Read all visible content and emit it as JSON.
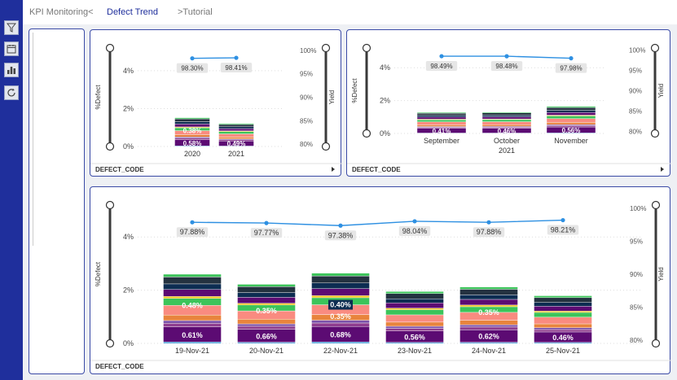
{
  "nav": {
    "kpi": "KPI Monitoring",
    "kpi_chevron": "<",
    "defect": "Defect Trend",
    "tutorial": ">Tutorial"
  },
  "sidebar": {
    "icons": [
      "filter-icon",
      "calendar-icon",
      "bar-chart-icon",
      "refresh-icon"
    ]
  },
  "colors": {
    "segments": [
      "#5c0b73",
      "#2d8fd0",
      "#8e3d8f",
      "#f98b80",
      "#e8843d",
      "#3cc45a",
      "#f0c419",
      "#0d2d52",
      "#243240",
      "#7b52aa"
    ],
    "line": "#2e90e2",
    "frame": "#3a4aa6"
  },
  "footer_label": "DEFECT_CODE",
  "chart_data": [
    {
      "type": "bar",
      "stacked": true,
      "categories": [
        "2020",
        "2021"
      ],
      "ylabel": "%Defect",
      "y2label": "Yield",
      "ylim": [
        0,
        5.2
      ],
      "y2lim": [
        79.5,
        100.5
      ],
      "yticks": [
        "4%",
        "2%",
        "0%"
      ],
      "y2ticks": [
        "100%",
        "95%",
        "90%",
        "85%",
        "80%"
      ],
      "totals": [
        1.52,
        1.21
      ],
      "highlights": [
        [
          0.58,
          0.38
        ],
        [
          0.49
        ]
      ],
      "yield": [
        98.3,
        98.41
      ],
      "yield_labels": [
        "98.30%",
        "98.41%"
      ]
    },
    {
      "type": "bar",
      "stacked": true,
      "categories": [
        "September",
        "October",
        "November"
      ],
      "xlabel_sub": "2021",
      "ylabel": "%Defect",
      "y2label": "Yield",
      "ylim": [
        0,
        5.2
      ],
      "y2lim": [
        79.5,
        100.5
      ],
      "yticks": [
        "4%",
        "2%",
        "0%"
      ],
      "y2ticks": [
        "100%",
        "95%",
        "90%",
        "85%",
        "80%"
      ],
      "totals": [
        1.28,
        1.3,
        1.64
      ],
      "highlights": [
        [
          0.41
        ],
        [
          0.46
        ],
        [
          0.56
        ]
      ],
      "yield": [
        98.49,
        98.48,
        97.98
      ],
      "yield_labels": [
        "98.49%",
        "98.48%",
        "97.98%"
      ]
    },
    {
      "type": "bar",
      "stacked": true,
      "categories": [
        "19-Nov-21",
        "20-Nov-21",
        "22-Nov-21",
        "23-Nov-21",
        "24-Nov-21",
        "25-Nov-21"
      ],
      "ylabel": "%Defect",
      "y2label": "Yield",
      "ylim": [
        0,
        5.2
      ],
      "y2lim": [
        79.5,
        100.5
      ],
      "yticks": [
        "4%",
        "2%",
        "0%"
      ],
      "y2ticks": [
        "100%",
        "95%",
        "90%",
        "85%",
        "80%"
      ],
      "totals": [
        2.6,
        2.22,
        2.64,
        1.95,
        2.12,
        1.79
      ],
      "highlights": [
        [
          0.61,
          0.48
        ],
        [
          0.66,
          0.35
        ],
        [
          0.68,
          0.4,
          0.35
        ],
        [
          0.56
        ],
        [
          0.62,
          0.35
        ],
        [
          0.46
        ]
      ],
      "yield": [
        97.88,
        97.77,
        97.38,
        98.04,
        97.88,
        98.21
      ],
      "yield_labels": [
        "97.88%",
        "97.77%",
        "97.38%",
        "98.04%",
        "97.88%",
        "98.21%"
      ]
    }
  ]
}
